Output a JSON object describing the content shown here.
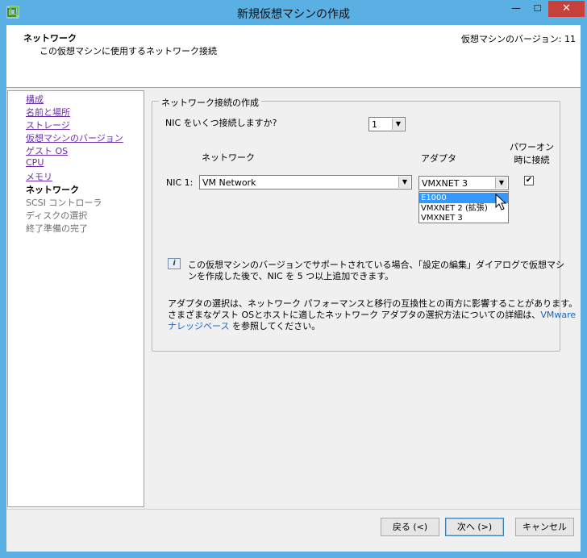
{
  "window": {
    "title": "新規仮想マシンの作成",
    "close_glyph": "✕",
    "min_glyph": "—",
    "max_glyph": "☐"
  },
  "header": {
    "title": "ネットワーク",
    "subtitle": "この仮想マシンに使用するネットワーク接続",
    "version": "仮想マシンのバージョン: 11"
  },
  "nav": {
    "items": [
      {
        "label": "構成",
        "state": "link"
      },
      {
        "label": "名前と場所",
        "state": "link"
      },
      {
        "label": "ストレージ",
        "state": "link"
      },
      {
        "label": "仮想マシンのバージョン",
        "state": "link"
      },
      {
        "label": "ゲスト OS",
        "state": "link"
      },
      {
        "label": "CPU",
        "state": "link"
      },
      {
        "label": "メモリ",
        "state": "link"
      },
      {
        "label": "ネットワーク",
        "state": "current"
      },
      {
        "label": "SCSI コントローラ",
        "state": "disabled"
      },
      {
        "label": "ディスクの選択",
        "state": "disabled"
      },
      {
        "label": "終了準備の完了",
        "state": "disabled"
      }
    ]
  },
  "group": {
    "legend": "ネットワーク接続の作成",
    "nic_count_label": "NIC をいくつ接続しますか?",
    "nic_count_value": "1",
    "col_network": "ネットワーク",
    "col_adapter": "アダプタ",
    "col_poweron_line1": "パワーオン",
    "col_poweron_line2": "時に接続",
    "nic1_label": "NIC 1:",
    "nic1_network": "VM Network",
    "nic1_adapter": "VMXNET 3",
    "nic1_connected": true,
    "adapter_options": [
      "E1000",
      "VMXNET 2 (拡張)",
      "VMXNET 3"
    ],
    "adapter_highlighted": "E1000",
    "info_line1": "この仮想マシンのバージョンでサポートされている場合、「設定の編集」ダイアログで仮想マシ",
    "info_line2": "ンを作成した後で、NIC を 5 つ以上追加できます。",
    "note_line1": "アダプタの選択は、ネットワーク パフォーマンスと移行の互換性との両方に影響することがあります。",
    "note_line2_a": "さまざまなゲスト OSとホストに適したネットワーク アダプタの選択方法についての詳細は、",
    "note_link_a": "VMware",
    "note_link_b": "ナレッジベース",
    "note_line3_b": " を参照してください。"
  },
  "buttons": {
    "back": "戻る (<)",
    "next": "次へ (>)",
    "cancel": "キャンセル"
  },
  "colors": {
    "titlebar": "#5ab0e3",
    "close": "#c7403a",
    "nav_link": "#6b2ea6",
    "link": "#1a66c8",
    "selection": "#3399ff"
  }
}
